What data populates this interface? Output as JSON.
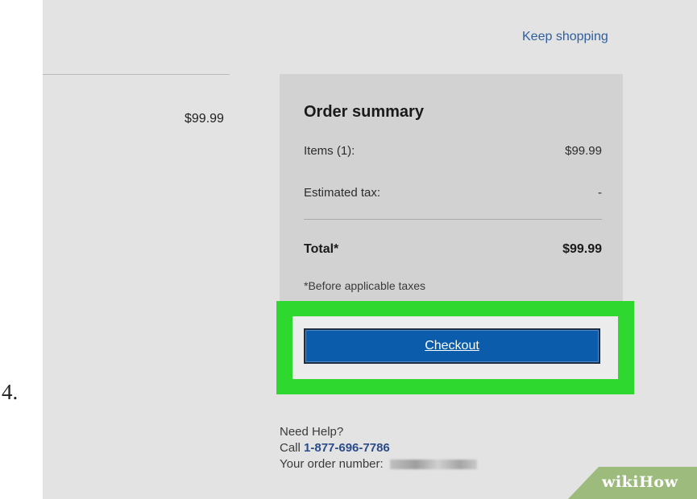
{
  "step": {
    "number": "4."
  },
  "header": {
    "keep_shopping_label": "Keep shopping"
  },
  "cart": {
    "item_price": "$99.99"
  },
  "order_summary": {
    "title": "Order summary",
    "items_label": "Items (1):",
    "items_value": "$99.99",
    "tax_label": "Estimated tax:",
    "tax_value": "-",
    "total_label": "Total*",
    "total_value": "$99.99",
    "tax_note": "*Before applicable taxes"
  },
  "checkout": {
    "button_label": "Checkout",
    "highlight_color": "#2fd82f",
    "button_color": "#0b5cab"
  },
  "help": {
    "title": "Need Help?",
    "call_prefix": "Call",
    "phone": "1-877-696-7786",
    "order_number_label": "Your order number:"
  },
  "watermark": {
    "wiki": "wiki",
    "how": "How"
  }
}
